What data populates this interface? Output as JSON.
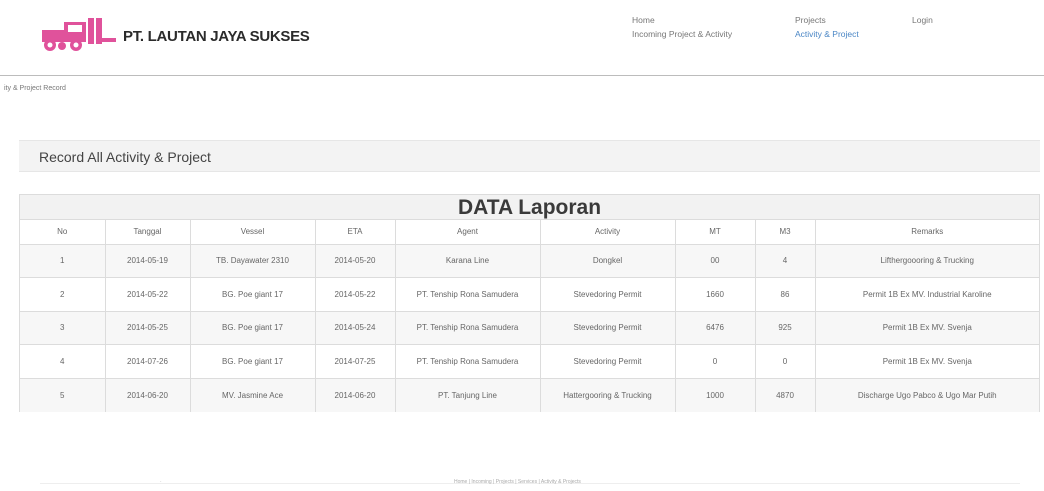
{
  "header": {
    "brand": "PT. LAUTAN JAYA SUKSES",
    "logo_icon": "truck-logo-icon",
    "colors": {
      "logo": "#e0529b",
      "nav_active": "#4a86c5"
    },
    "nav": {
      "home": "Home",
      "incoming": "Incoming Project & Activity",
      "projects": "Projects",
      "activity_project": "Activity & Project",
      "login": "Login"
    }
  },
  "breadcrumb": "ity & Project Record",
  "panel_title": "Record All Activity & Project",
  "report": {
    "title": "DATA Laporan",
    "columns": [
      "No",
      "Tanggal",
      "Vessel",
      "ETA",
      "Agent",
      "Activity",
      "MT",
      "M3",
      "Remarks"
    ],
    "rows": [
      [
        "1",
        "2014-05-19",
        "TB. Dayawater 2310",
        "2014-05-20",
        "Karana Line",
        "Dongkel",
        "00",
        "4",
        "Lifthergoooring & Trucking"
      ],
      [
        "2",
        "2014-05-22",
        "BG. Poe giant 17",
        "2014-05-22",
        "PT. Tenship Rona Samudera",
        "Stevedoring Permit",
        "1660",
        "86",
        "Permit 1B Ex MV. Industrial Karoline"
      ],
      [
        "3",
        "2014-05-25",
        "BG. Poe giant 17",
        "2014-05-24",
        "PT. Tenship Rona Samudera",
        "Stevedoring Permit",
        "6476",
        "925",
        "Permit 1B Ex MV. Svenja"
      ],
      [
        "4",
        "2014-07-26",
        "BG. Poe giant 17",
        "2014-07-25",
        "PT. Tenship Rona Samudera",
        "Stevedoring Permit",
        "0",
        "0",
        "Permit 1B Ex MV. Svenja"
      ],
      [
        "5",
        "2014-06-20",
        "MV. Jasmine Ace",
        "2014-06-20",
        "PT. Tanjung Line",
        "Hattergooring & Trucking",
        "1000",
        "4870",
        "Discharge Ugo Pabco & Ugo Mar Putih"
      ]
    ]
  },
  "footer": {
    "left": "·",
    "links": "Home | Incoming | Projects | Services | Activity & Projects"
  }
}
